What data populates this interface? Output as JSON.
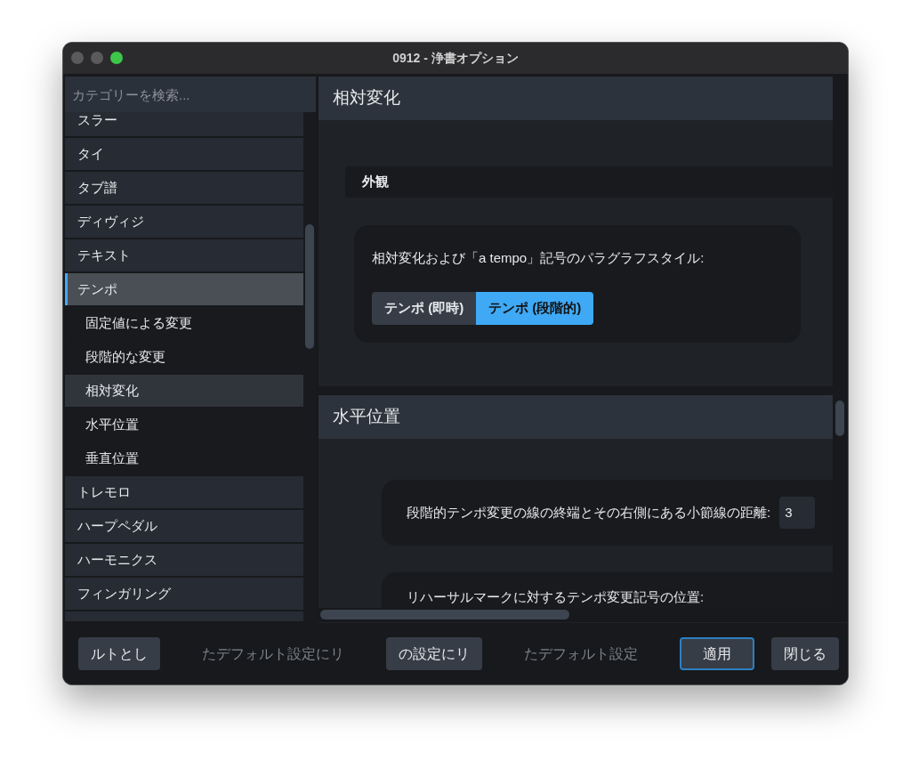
{
  "window": {
    "title": "0912 - 浄書オプション"
  },
  "sidebar": {
    "search": {
      "placeholder": "カテゴリーを検索..."
    },
    "items": [
      {
        "label": "スラー",
        "selected": false
      },
      {
        "label": "タイ",
        "selected": false
      },
      {
        "label": "タブ譜",
        "selected": false
      },
      {
        "label": "ディヴィジ",
        "selected": false
      },
      {
        "label": "テキスト",
        "selected": false
      },
      {
        "label": "テンポ",
        "selected": true,
        "children": [
          {
            "label": "固定値による変更",
            "selected": false
          },
          {
            "label": "段階的な変更",
            "selected": false
          },
          {
            "label": "相対変化",
            "selected": true
          },
          {
            "label": "水平位置",
            "selected": false
          },
          {
            "label": "垂直位置",
            "selected": false
          }
        ]
      },
      {
        "label": "トレモロ",
        "selected": false
      },
      {
        "label": "ハープペダル",
        "selected": false
      },
      {
        "label": "ハーモニクス",
        "selected": false
      },
      {
        "label": "フィンガリング",
        "selected": false
      }
    ]
  },
  "sections": [
    {
      "title": "相対変化",
      "groups": [
        {
          "title": "外観",
          "options": [
            {
              "kind": "segmented",
              "label": "相対変化および「a tempo」記号のパラグラフスタイル:",
              "choices": [
                {
                  "label": "テンポ (即時)",
                  "selected": false
                },
                {
                  "label": "テンポ (段階的)",
                  "selected": true
                }
              ]
            }
          ]
        }
      ]
    },
    {
      "title": "水平位置",
      "groups": [
        {
          "options": [
            {
              "kind": "field",
              "label": "段階的テンポ変更の線の終端とその右側にある小節線の距離:",
              "value": "3"
            },
            {
              "kind": "text",
              "label": "リハーサルマークに対するテンポ変更記号の位置:"
            }
          ]
        }
      ]
    }
  ],
  "footer": [
    {
      "label": "ルトとし",
      "disabled": false,
      "primary": false
    },
    {
      "label": "たデフォルト設定にリ",
      "disabled": true,
      "primary": false
    },
    {
      "label": "の設定にリ",
      "disabled": false,
      "primary": false
    },
    {
      "label": "たデフォルト設定",
      "disabled": true,
      "primary": false
    },
    {
      "label": "適用",
      "disabled": false,
      "primary": true
    },
    {
      "label": "閉じる",
      "disabled": false,
      "primary": false
    }
  ]
}
